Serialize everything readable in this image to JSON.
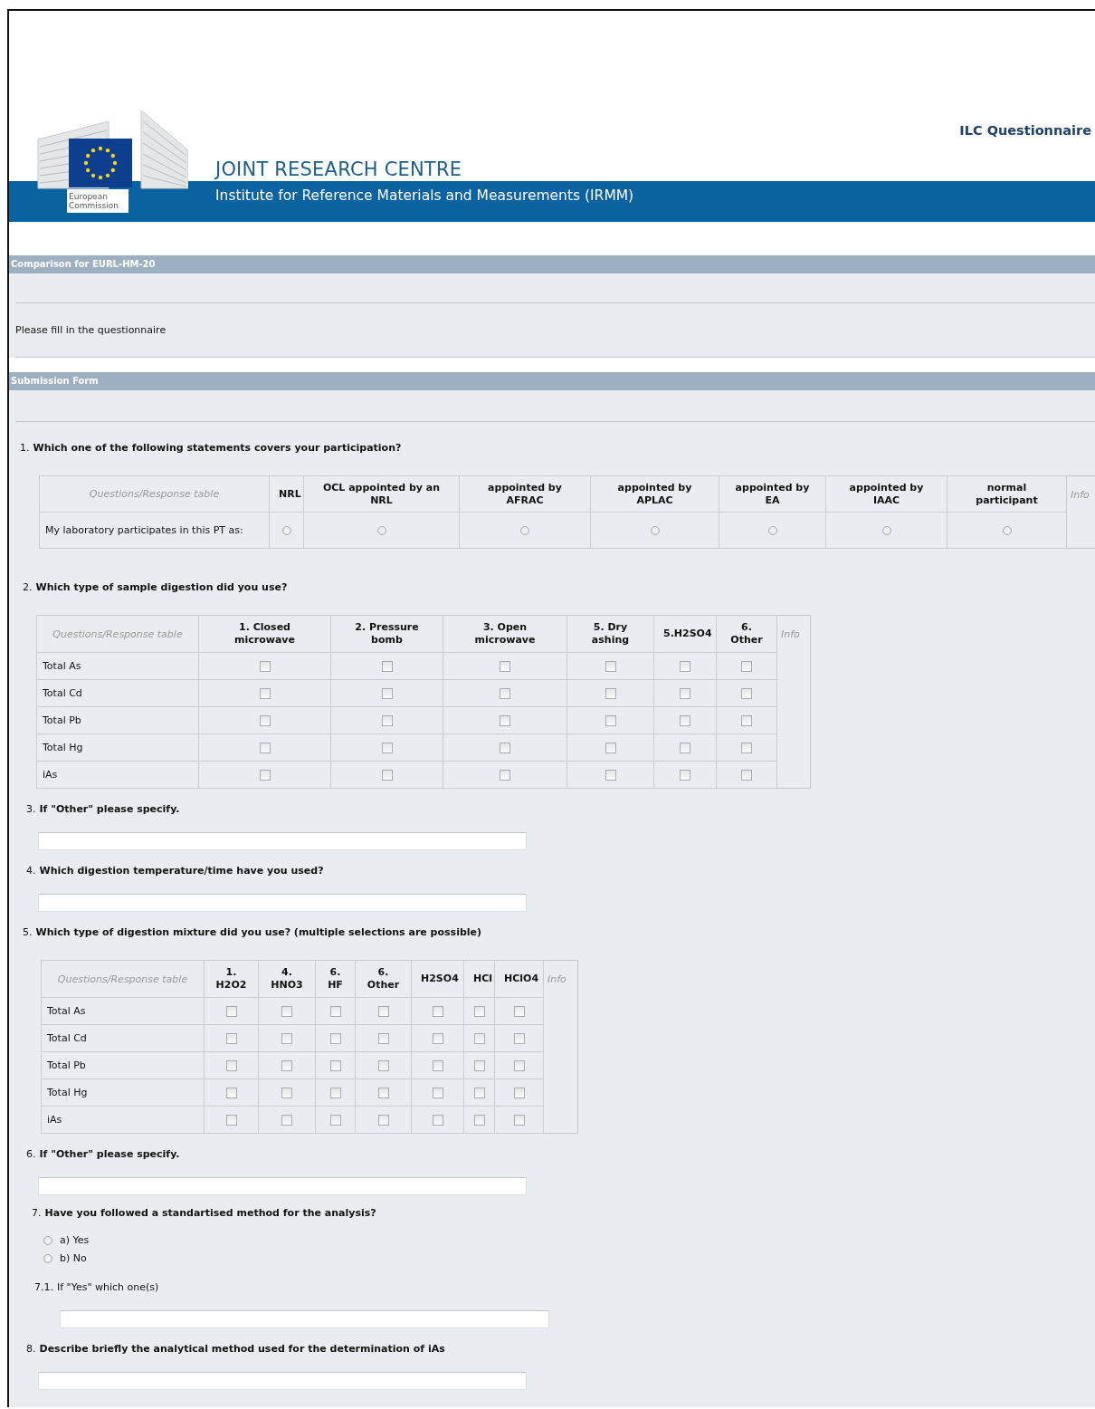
{
  "header": {
    "logo_caption": "European Commission",
    "org_title": "JOINT RESEARCH CENTRE",
    "institute": "Institute for Reference Materials and Measurements (IRMM)",
    "app_title": "ILC Questionnaire"
  },
  "comparison": {
    "title": "Comparison for EURL-HM-20",
    "intro": "Please fill in the questionnaire"
  },
  "form": {
    "title": "Submission Form",
    "questions": [
      {
        "kind": "radio_table",
        "number": "1.",
        "text": "Which one of the following statements covers your participation?",
        "table": {
          "corner": "Questions/Response table",
          "info": "Info",
          "columns": [
            "NRL",
            "OCL appointed by an NRL",
            "appointed by AFRAC",
            "appointed by APLAC",
            "appointed by EA",
            "appointed by IAAC",
            "normal participant"
          ],
          "rows": [
            {
              "label": "My laboratory participates in this PT as:",
              "options": [
                {
                  "selected": false
                },
                {
                  "selected": false
                },
                {
                  "selected": false
                },
                {
                  "selected": false
                },
                {
                  "selected": false
                },
                {
                  "selected": false
                },
                {
                  "selected": false
                }
              ]
            }
          ]
        }
      },
      {
        "kind": "checkbox_table",
        "number": "2.",
        "text": "Which type of sample digestion did you use?",
        "table": {
          "corner": "Questions/Response table",
          "info": "Info",
          "columns": [
            "1. Closed microwave",
            "2. Pressure bomb",
            "3. Open microwave",
            "5. Dry ashing",
            "5.H2SO4",
            "6. Other"
          ],
          "rows": [
            {
              "label": "Total As",
              "options": [
                {
                  "checked": false
                },
                {
                  "checked": false
                },
                {
                  "checked": false
                },
                {
                  "checked": false
                },
                {
                  "checked": false
                },
                {
                  "checked": false
                }
              ]
            },
            {
              "label": "Total Cd",
              "options": [
                {
                  "checked": false
                },
                {
                  "checked": false
                },
                {
                  "checked": false
                },
                {
                  "checked": false
                },
                {
                  "checked": false
                },
                {
                  "checked": false
                }
              ]
            },
            {
              "label": "Total Pb",
              "options": [
                {
                  "checked": false
                },
                {
                  "checked": false
                },
                {
                  "checked": false
                },
                {
                  "checked": false
                },
                {
                  "checked": false
                },
                {
                  "checked": false
                }
              ]
            },
            {
              "label": "Total Hg",
              "options": [
                {
                  "checked": false
                },
                {
                  "checked": false
                },
                {
                  "checked": false
                },
                {
                  "checked": false
                },
                {
                  "checked": false
                },
                {
                  "checked": false
                }
              ]
            },
            {
              "label": "iAs",
              "options": [
                {
                  "checked": false
                },
                {
                  "checked": false
                },
                {
                  "checked": false
                },
                {
                  "checked": false
                },
                {
                  "checked": false
                },
                {
                  "checked": false
                }
              ]
            }
          ]
        }
      },
      {
        "kind": "text",
        "number": "3.",
        "text": "If \"Other\" please specify."
      },
      {
        "kind": "text",
        "number": "4.",
        "text": "Which digestion temperature/time have you used?"
      },
      {
        "kind": "checkbox_table",
        "number": "5.",
        "text": "Which type of digestion mixture did you use? (multiple selections are possible)",
        "table": {
          "corner": "Questions/Response table",
          "info": "Info",
          "columns": [
            "1. H2O2",
            "4. HNO3",
            "6. HF",
            "6. Other",
            "H2SO4",
            "HCl",
            "HClO4"
          ],
          "rows": [
            {
              "label": "Total As",
              "options": [
                {
                  "checked": false
                },
                {
                  "checked": false
                },
                {
                  "checked": false
                },
                {
                  "checked": false
                },
                {
                  "checked": false
                },
                {
                  "checked": false
                },
                {
                  "checked": false
                }
              ]
            },
            {
              "label": "Total Cd",
              "options": [
                {
                  "checked": false
                },
                {
                  "checked": false
                },
                {
                  "checked": false
                },
                {
                  "checked": false
                },
                {
                  "checked": false
                },
                {
                  "checked": false
                },
                {
                  "checked": false
                }
              ]
            },
            {
              "label": "Total Pb",
              "options": [
                {
                  "checked": false
                },
                {
                  "checked": false
                },
                {
                  "checked": false
                },
                {
                  "checked": false
                },
                {
                  "checked": false
                },
                {
                  "checked": false
                },
                {
                  "checked": false
                }
              ]
            },
            {
              "label": "Total Hg",
              "options": [
                {
                  "checked": false
                },
                {
                  "checked": false
                },
                {
                  "checked": false
                },
                {
                  "checked": false
                },
                {
                  "checked": false
                },
                {
                  "checked": false
                },
                {
                  "checked": false
                }
              ]
            },
            {
              "label": "iAs",
              "options": [
                {
                  "checked": false
                },
                {
                  "checked": false
                },
                {
                  "checked": false
                },
                {
                  "checked": false
                },
                {
                  "checked": false
                },
                {
                  "checked": false
                },
                {
                  "checked": false
                }
              ]
            }
          ]
        }
      },
      {
        "kind": "text",
        "number": "6.",
        "text": "If \"Other\" please specify."
      },
      {
        "kind": "choice",
        "number": "7.",
        "text": "Have you followed a standartised method for the analysis?",
        "options": [
          {
            "label": "a) Yes",
            "selected": false
          },
          {
            "label": "b) No",
            "selected": false
          }
        ]
      },
      {
        "kind": "sub_text",
        "number": "7.1.",
        "text": "If \"Yes\" which one(s)"
      },
      {
        "kind": "text",
        "number": "8.",
        "text": "Describe briefly the analytical method used for the determination of iAs"
      }
    ]
  }
}
